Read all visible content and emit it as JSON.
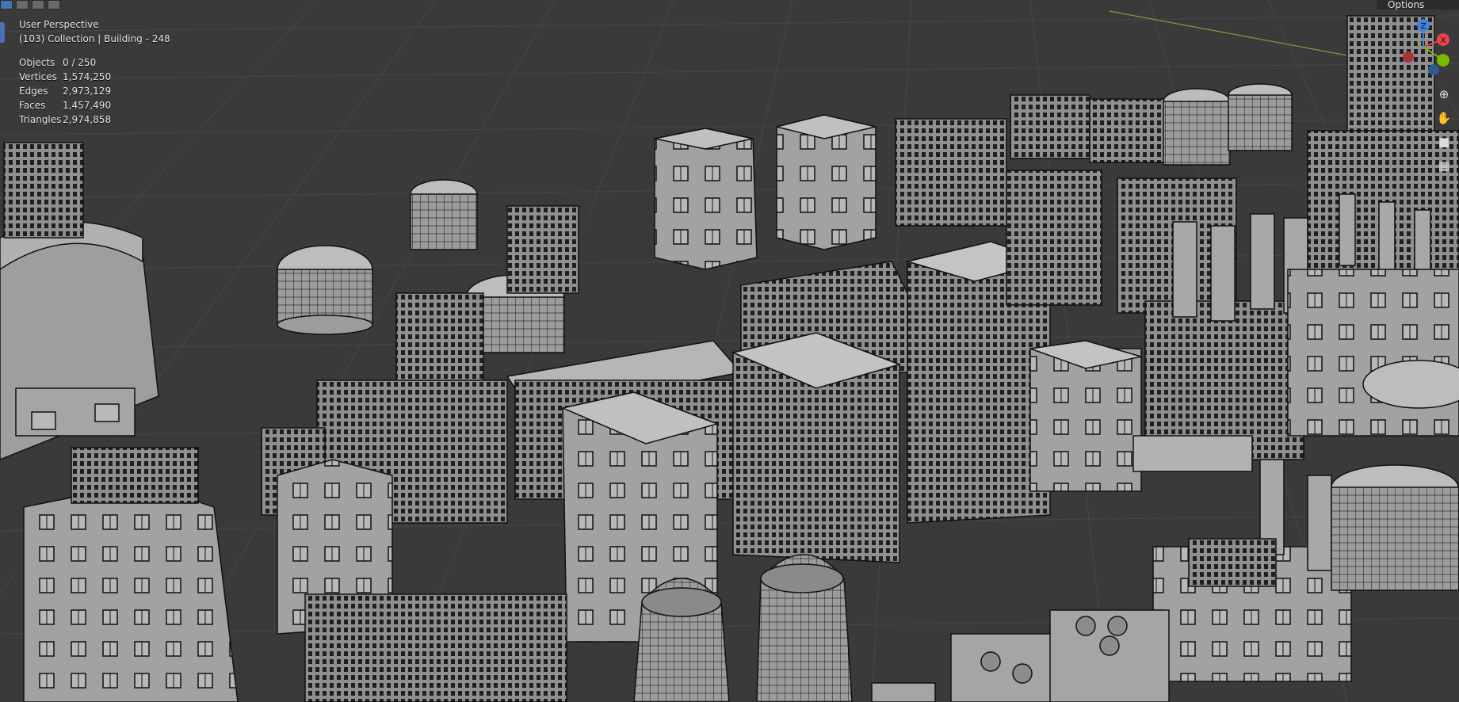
{
  "viewport": {
    "title_line": "User Perspective",
    "collection_line": "(103) Collection | Building - 248",
    "stats": [
      {
        "label": "Objects",
        "value": "0 / 250"
      },
      {
        "label": "Vertices",
        "value": "1,574,250"
      },
      {
        "label": "Edges",
        "value": "2,973,129"
      },
      {
        "label": "Faces",
        "value": "1,457,490"
      },
      {
        "label": "Triangles",
        "value": "2,974,858"
      }
    ],
    "options_label": "Options",
    "gizmo": {
      "x": "X",
      "y": "Y",
      "z": "Z"
    }
  },
  "colors": {
    "grid_bg": "#3a3a3a",
    "grid_line": "#474747",
    "building_fill": "#9b9b9b",
    "building_top": "#b4b4b4",
    "wire": "#111111",
    "x_axis": "#e8424b",
    "y_axis": "#7ab800",
    "z_axis": "#3b84d9"
  },
  "icons": [
    "zoom-icon",
    "hand-pan-icon",
    "camera-icon",
    "grid-perspective-icon"
  ]
}
